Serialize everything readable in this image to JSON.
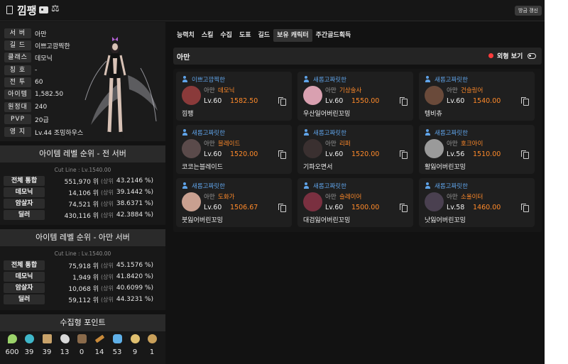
{
  "header": {
    "name": "낌팽",
    "refresh_label": "방금 갱신"
  },
  "profile": {
    "rows": [
      {
        "label": "서 버",
        "value": "아만"
      },
      {
        "label": "길 드",
        "value": "이쁘고깜찍한"
      },
      {
        "label": "클래스",
        "value": "데모닉"
      },
      {
        "label": "칭 호",
        "value": "-"
      },
      {
        "label": "전 투",
        "value": "60"
      },
      {
        "label": "아이템",
        "value": "1,582.50"
      },
      {
        "label": "원정대",
        "value": "240"
      },
      {
        "label": "PVP",
        "value": "20급"
      },
      {
        "label": "영 지",
        "value": "Lv.44 조밍하우스"
      }
    ]
  },
  "ranking_all": {
    "title": "아이템 레벨 순위 - 전 서버",
    "cutline": "Cut Line : Lv.1540.00",
    "rows": [
      {
        "label": "전체 통합",
        "rank": "551,970 위",
        "sub": "(상위",
        "pct": "43.2146 %)"
      },
      {
        "label": "데모닉",
        "rank": "14,106 위",
        "sub": "(상위",
        "pct": "39.1442 %)"
      },
      {
        "label": "암살자",
        "rank": "74,521 위",
        "sub": "(상위",
        "pct": "38.6371 %)"
      },
      {
        "label": "딜러",
        "rank": "430,116 위",
        "sub": "(상위",
        "pct": "42.3884 %)"
      }
    ]
  },
  "ranking_server": {
    "title": "아이템 레벨 순위 - 아만 서버",
    "cutline": "Cut Line : Lv.1540.00",
    "rows": [
      {
        "label": "전체 통합",
        "rank": "75,918 위",
        "sub": "(상위",
        "pct": "45.1576 %)"
      },
      {
        "label": "데모닉",
        "rank": "1,949 위",
        "sub": "(상위",
        "pct": "41.8420 %)"
      },
      {
        "label": "암살자",
        "rank": "10,068 위",
        "sub": "(상위",
        "pct": "40.6099 %)"
      },
      {
        "label": "딜러",
        "rank": "59,112 위",
        "sub": "(상위",
        "pct": "44.3231 %)"
      }
    ]
  },
  "collection": {
    "title": "수집형 포인트",
    "items": [
      {
        "icon": "mokoko-seed-icon",
        "value": "600",
        "color": "#9bd36a"
      },
      {
        "icon": "island-heart-icon",
        "value": "39",
        "color": "#3fb7c9"
      },
      {
        "icon": "art-icon",
        "value": "39",
        "color": "#c9a36a"
      },
      {
        "icon": "giant-heart-icon",
        "value": "13",
        "color": "#d9d9d9"
      },
      {
        "icon": "ignea-token-icon",
        "value": "0",
        "color": "#8a6a4a"
      },
      {
        "icon": "adventure-tome-icon",
        "value": "14",
        "color": "#c98a3a"
      },
      {
        "icon": "sea-bounty-icon",
        "value": "53",
        "color": "#5fb0e8"
      },
      {
        "icon": "world-tree-leaf-icon",
        "value": "9",
        "color": "#e0c070"
      },
      {
        "icon": "orpheus-star-icon",
        "value": "1",
        "color": "#c9a05a"
      }
    ]
  },
  "tabs": [
    "능력치",
    "스킬",
    "수집",
    "도표",
    "길드",
    "보유 캐릭터",
    "주간골드획득"
  ],
  "active_tab": 5,
  "server_bar": {
    "server": "아만",
    "appearance_label": "외형 보기"
  },
  "characters": [
    {
      "guild": "이쁘고깜찍한",
      "server": "아만",
      "class": "데모닉",
      "level": "Lv.60",
      "ilvl": "1582.50",
      "name": "낌팽",
      "av": "#8a3a3a"
    },
    {
      "guild": "새롭고짜릿한",
      "server": "아만",
      "class": "기상술사",
      "level": "Lv.60",
      "ilvl": "1550.00",
      "name": "우산일어버린꼬밍",
      "av": "#d9a0b0"
    },
    {
      "guild": "새롭고짜릿한",
      "server": "아만",
      "class": "건슬링어",
      "level": "Lv.60",
      "ilvl": "1540.00",
      "name": "텡비츄",
      "av": "#6a4a3a"
    },
    {
      "guild": "새롭고짜릿한",
      "server": "아만",
      "class": "블레이드",
      "level": "Lv.60",
      "ilvl": "1520.00",
      "name": "코코는블레이드",
      "av": "#5a4a4a"
    },
    {
      "guild": "새롭고짜릿한",
      "server": "아만",
      "class": "리퍼",
      "level": "Lv.60",
      "ilvl": "1520.00",
      "name": "기파오면서",
      "av": "#3a3030"
    },
    {
      "guild": "새롭고짜릿한",
      "server": "아만",
      "class": "호크아이",
      "level": "Lv.56",
      "ilvl": "1510.00",
      "name": "활잃어버린꼬밍",
      "av": "#9a9a9a"
    },
    {
      "guild": "새롭고짜릿한",
      "server": "아만",
      "class": "도화가",
      "level": "Lv.60",
      "ilvl": "1506.67",
      "name": "붓잃어버린꼬밍",
      "av": "#c9a090"
    },
    {
      "guild": "새롭고짜릿한",
      "server": "아만",
      "class": "슬레이어",
      "level": "Lv.60",
      "ilvl": "1500.00",
      "name": "대검잃어버린꼬밍",
      "av": "#7a3040"
    },
    {
      "guild": "새롭고짜릿한",
      "server": "아만",
      "class": "소울이터",
      "level": "Lv.58",
      "ilvl": "1460.00",
      "name": "낫잃어버린꼬밍",
      "av": "#4a4050"
    }
  ]
}
